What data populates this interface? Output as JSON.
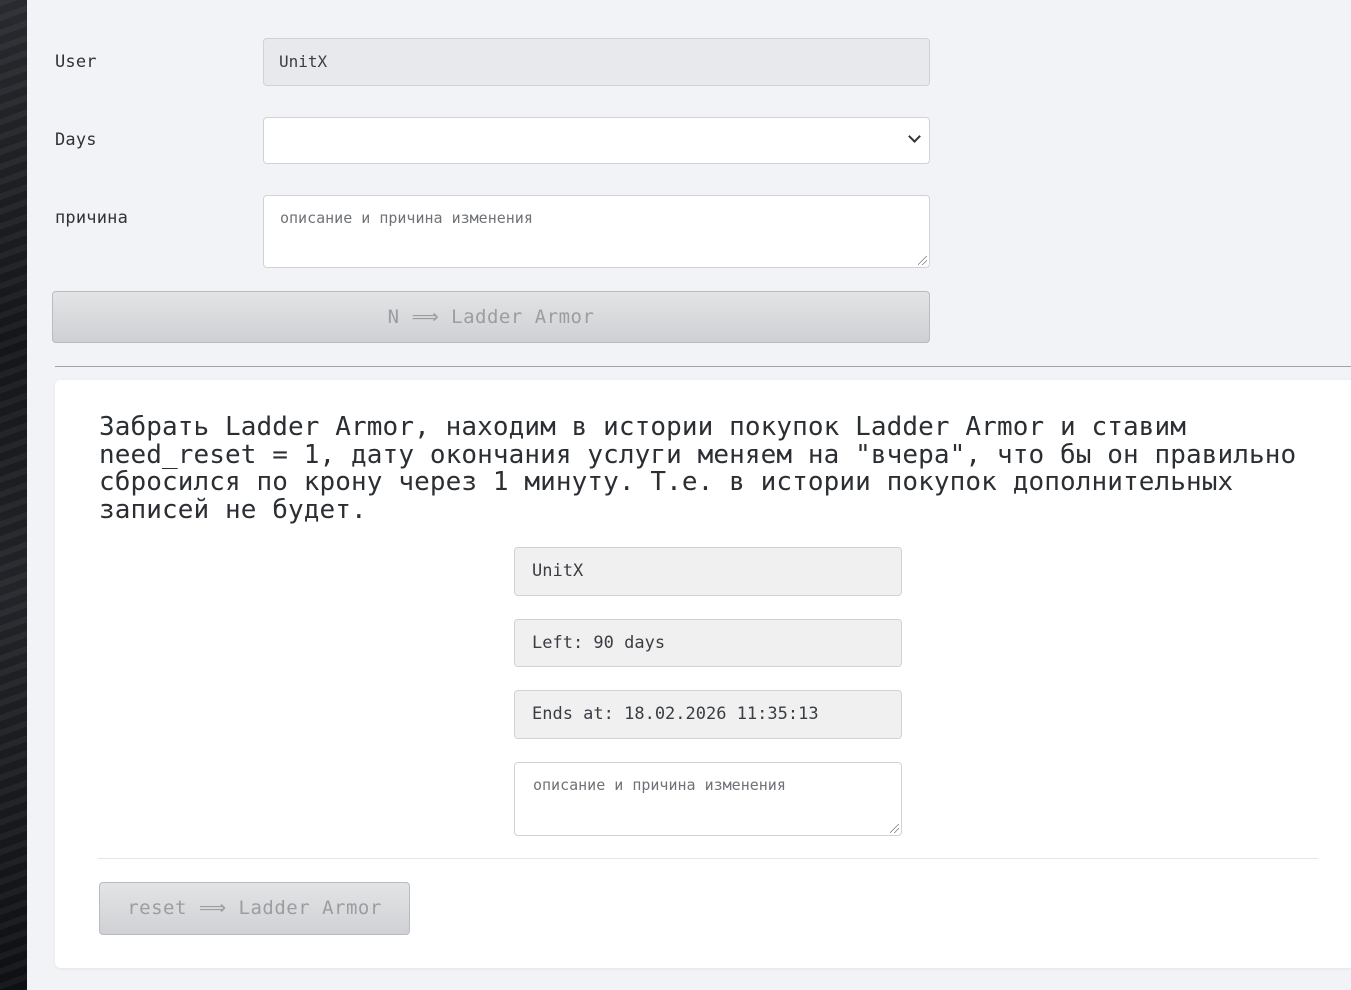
{
  "form": {
    "user_label": "User",
    "user_value": "UnitX",
    "days_label": "Days",
    "days_value": "",
    "reason_label": "причина",
    "reason_placeholder": "описание и причина изменения",
    "submit_label": "N ⟹ Ladder Armor"
  },
  "reset_card": {
    "description": "Забрать Ladder Armor, находим в истории покупок Ladder Armor и ставим need_reset = 1, дату окончания услуги меняем на \"вчера\", что бы он правильно сбросился по крону через 1 минуту. Т.е. в истории покупок дополнительных записей не будет.",
    "user_value": "UnitX",
    "left_value": "Left: 90 days",
    "ends_value": "Ends at: 18.02.2026 11:35:13",
    "reason_placeholder": "описание и причина изменения",
    "reset_label": "reset ⟹ Ladder Armor"
  }
}
